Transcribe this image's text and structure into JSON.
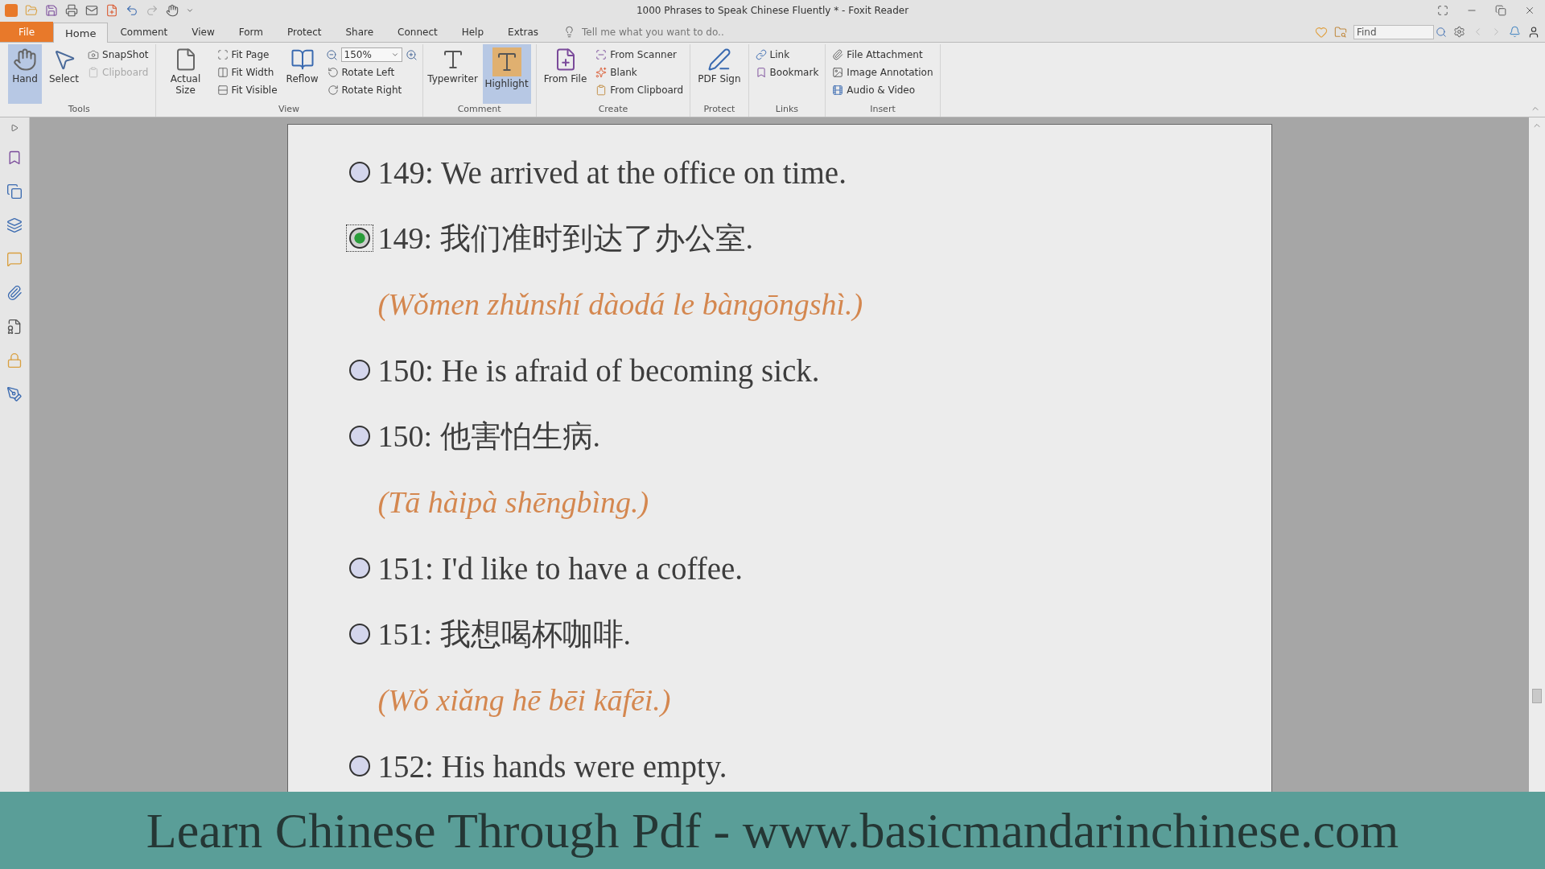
{
  "window": {
    "title": "1000 Phrases to Speak Chinese Fluently * - Foxit Reader"
  },
  "tabs": [
    {
      "label": "File",
      "selected": false,
      "kind": "file"
    },
    {
      "label": "Home",
      "selected": true,
      "kind": "tab"
    },
    {
      "label": "Comment",
      "selected": false,
      "kind": "tab"
    },
    {
      "label": "View",
      "selected": false,
      "kind": "tab"
    },
    {
      "label": "Form",
      "selected": false,
      "kind": "tab"
    },
    {
      "label": "Protect",
      "selected": false,
      "kind": "tab"
    },
    {
      "label": "Share",
      "selected": false,
      "kind": "tab"
    },
    {
      "label": "Connect",
      "selected": false,
      "kind": "tab"
    },
    {
      "label": "Help",
      "selected": false,
      "kind": "tab"
    },
    {
      "label": "Extras",
      "selected": false,
      "kind": "tab"
    }
  ],
  "tell_me": {
    "placeholder": "Tell me what you want to do.."
  },
  "find": {
    "placeholder": "Find"
  },
  "ribbon": {
    "groups": [
      {
        "label": "Tools",
        "items": [
          {
            "kind": "large",
            "label": "Hand",
            "selected": true,
            "disabled": false
          },
          {
            "kind": "large",
            "label": "Select",
            "selected": false,
            "disabled": false
          },
          {
            "kind": "small",
            "label": "SnapShot",
            "selected": false,
            "disabled": false
          },
          {
            "kind": "small",
            "label": "Clipboard",
            "selected": false,
            "disabled": true
          }
        ]
      },
      {
        "label": "View",
        "items": [
          {
            "kind": "large",
            "label": "Actual Size",
            "selected": false,
            "disabled": false
          },
          {
            "kind": "small",
            "label": "Fit Page",
            "selected": false,
            "disabled": false
          },
          {
            "kind": "small",
            "label": "Fit Width",
            "selected": false,
            "disabled": false
          },
          {
            "kind": "small",
            "label": "Fit Visible",
            "selected": false,
            "disabled": false
          },
          {
            "kind": "large",
            "label": "Reflow",
            "selected": false,
            "disabled": false
          },
          {
            "kind": "combo",
            "label": "150%",
            "selected": false,
            "disabled": false
          },
          {
            "kind": "small",
            "label": "Rotate Left",
            "selected": false,
            "disabled": false
          },
          {
            "kind": "small",
            "label": "Rotate Right",
            "selected": false,
            "disabled": false
          }
        ]
      },
      {
        "label": "Comment",
        "items": [
          {
            "kind": "large",
            "label": "Typewriter",
            "selected": false,
            "disabled": false
          },
          {
            "kind": "large",
            "label": "Highlight",
            "selected": true,
            "disabled": false
          }
        ]
      },
      {
        "label": "Create",
        "items": [
          {
            "kind": "large",
            "label": "From File",
            "selected": false,
            "disabled": false
          },
          {
            "kind": "small",
            "label": "From Scanner",
            "selected": false,
            "disabled": false
          },
          {
            "kind": "small",
            "label": "Blank",
            "selected": false,
            "disabled": false
          },
          {
            "kind": "small",
            "label": "From Clipboard",
            "selected": false,
            "disabled": false
          }
        ]
      },
      {
        "label": "Protect",
        "items": [
          {
            "kind": "large",
            "label": "PDF Sign",
            "selected": false,
            "disabled": false
          }
        ]
      },
      {
        "label": "Links",
        "items": [
          {
            "kind": "small",
            "label": "Link",
            "selected": false,
            "disabled": false
          },
          {
            "kind": "small",
            "label": "Bookmark",
            "selected": false,
            "disabled": false
          }
        ]
      },
      {
        "label": "Insert",
        "items": [
          {
            "kind": "small",
            "label": "File Attachment",
            "selected": false,
            "disabled": false
          },
          {
            "kind": "small",
            "label": "Image Annotation",
            "selected": false,
            "disabled": false
          },
          {
            "kind": "small",
            "label": "Audio & Video",
            "selected": false,
            "disabled": false
          }
        ]
      }
    ]
  },
  "document": {
    "rows": [
      {
        "kind": "english",
        "text": "149: We arrived at the office on time.",
        "focused": false
      },
      {
        "kind": "chinese",
        "text": "149: 我们准时到达了办公室.",
        "focused": true
      },
      {
        "kind": "pinyin",
        "text": "(Wǒmen zhǔnshí dàodá le bàngōngshì.)"
      },
      {
        "kind": "english",
        "text": "150: He is afraid of becoming sick.",
        "focused": false
      },
      {
        "kind": "chinese",
        "text": "150: 他害怕生病.",
        "focused": false
      },
      {
        "kind": "pinyin",
        "text": "(Tā hàipà shēngbìng.)"
      },
      {
        "kind": "english",
        "text": "151: I'd like to have a coffee.",
        "focused": false
      },
      {
        "kind": "chinese",
        "text": "151: 我想喝杯咖啡.",
        "focused": false
      },
      {
        "kind": "pinyin",
        "text": "(Wǒ xiǎng hē bēi kāfēi.)"
      },
      {
        "kind": "english",
        "text": "152: His hands were empty.",
        "focused": false
      }
    ]
  },
  "banner": {
    "text": "Learn Chinese Through Pdf - www.basicmandarinchinese.com"
  }
}
